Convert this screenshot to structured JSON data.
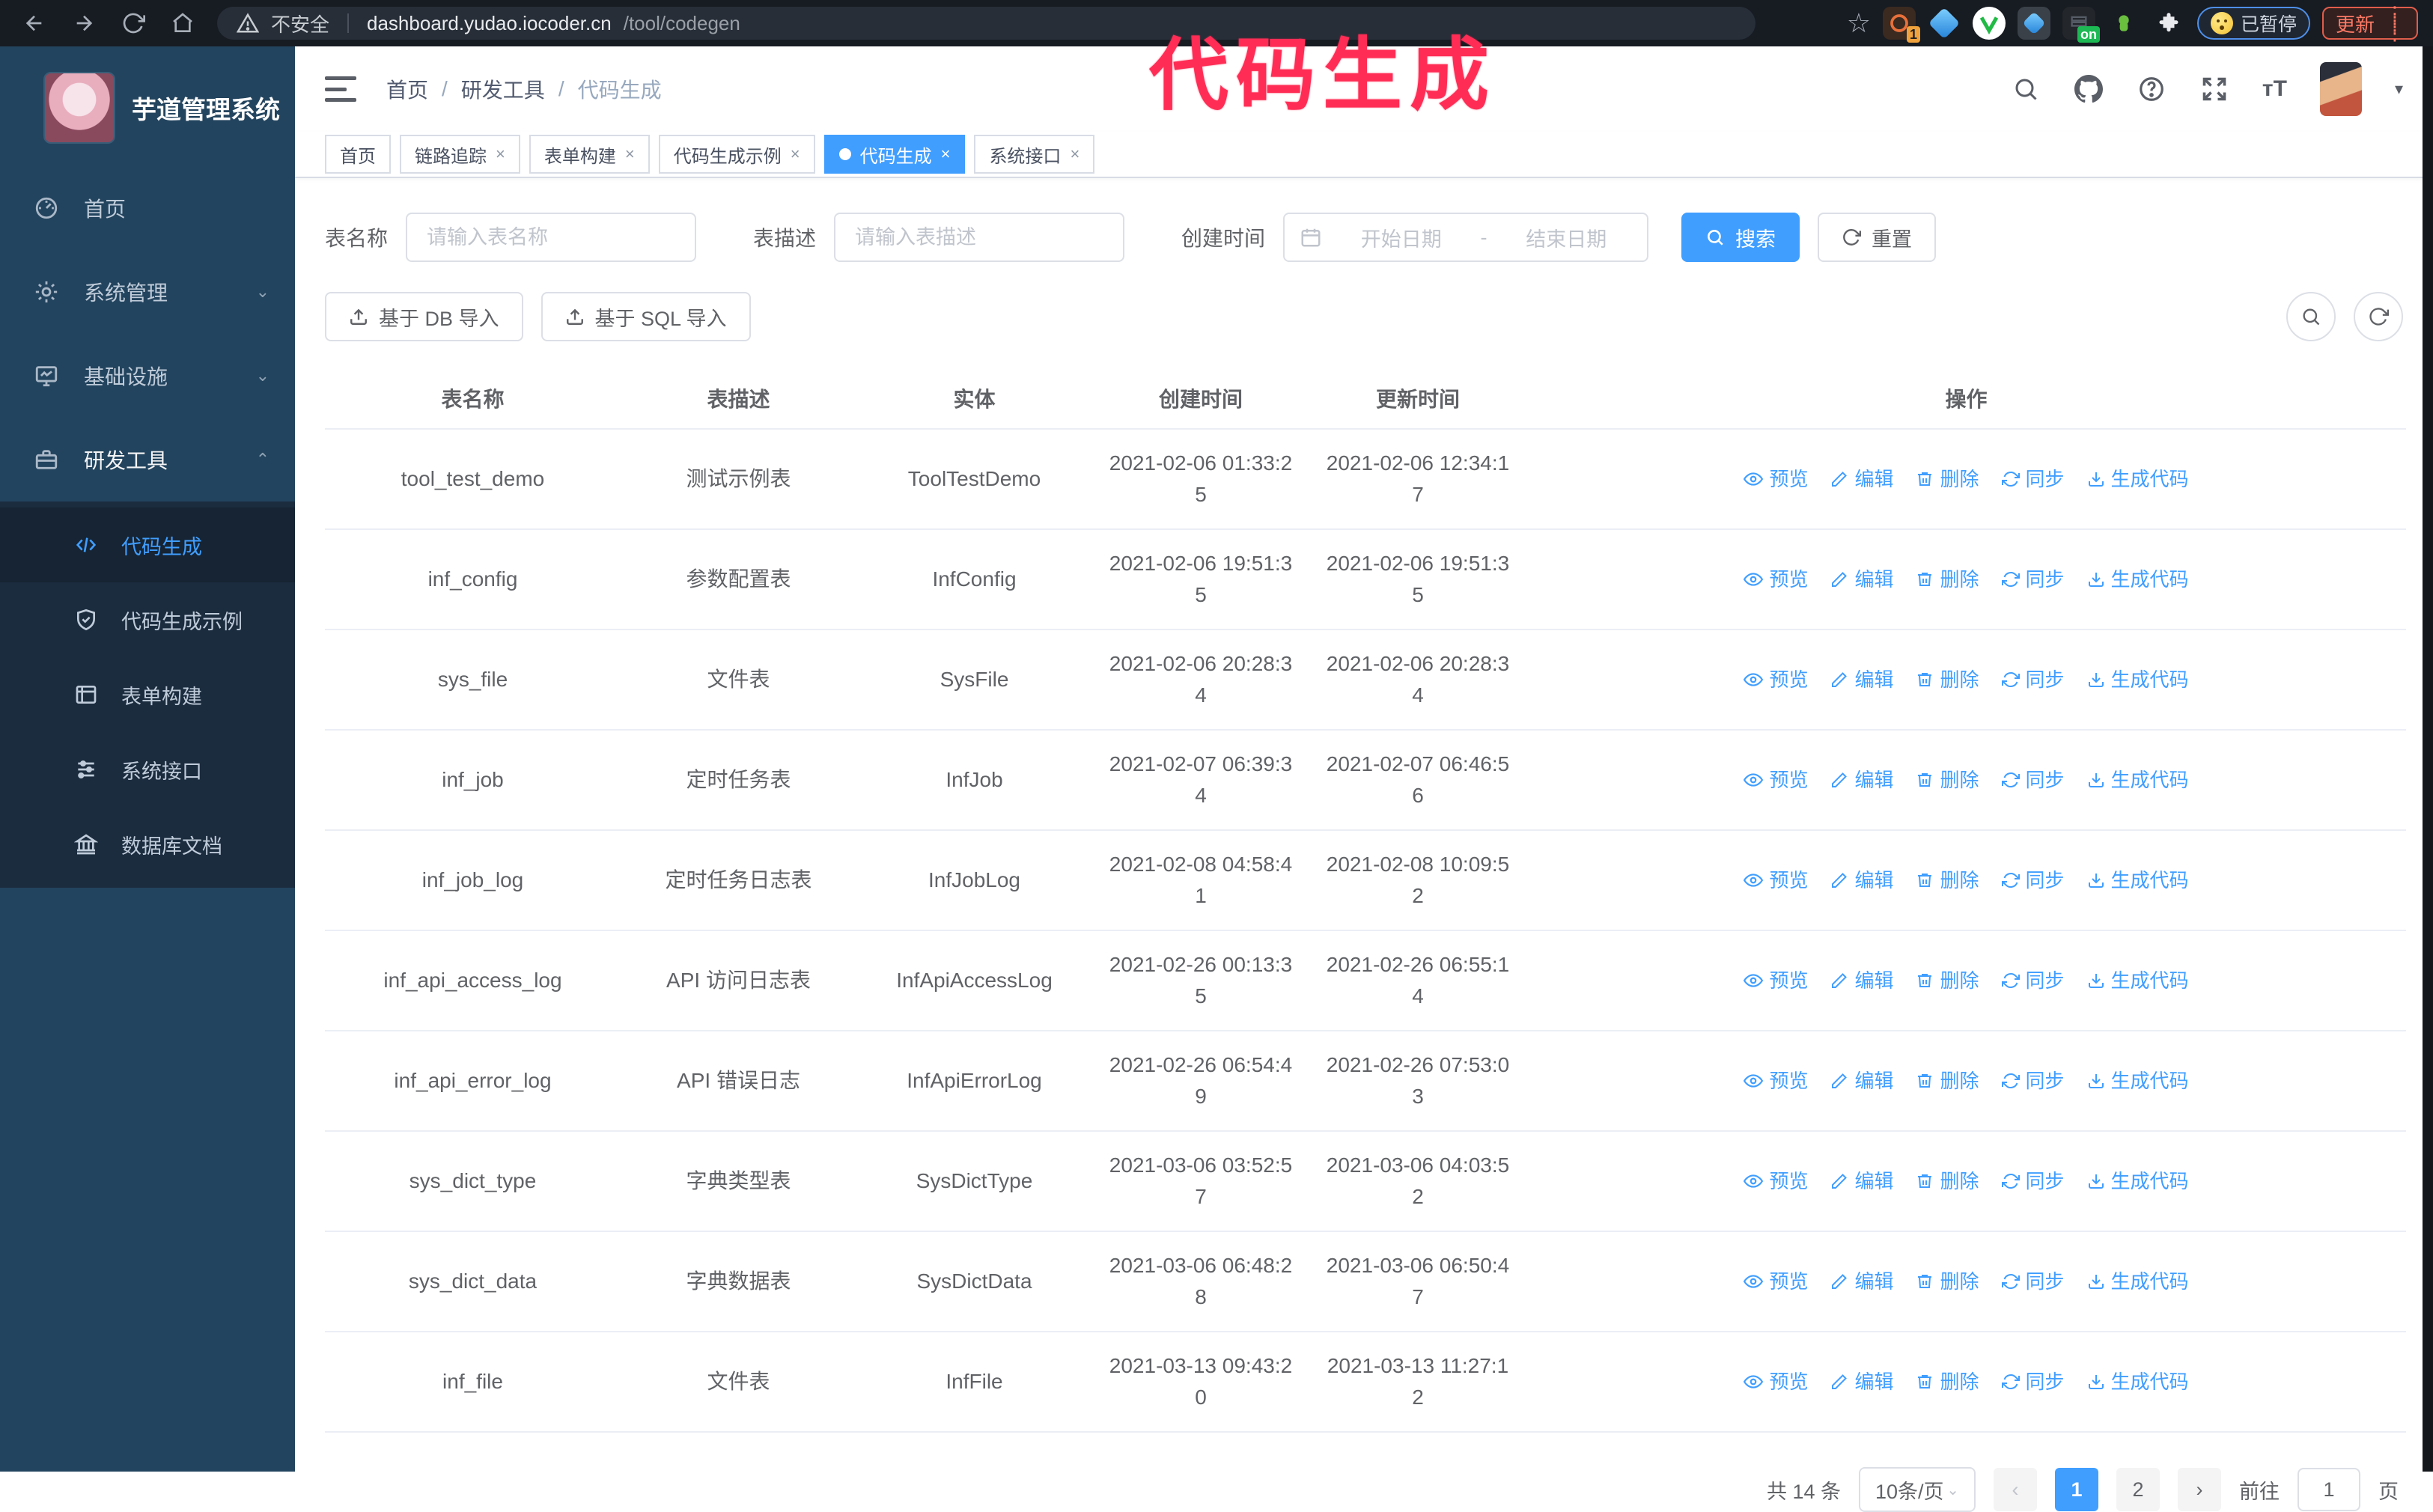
{
  "browser": {
    "security_label": "不安全",
    "url_host": "dashboard.yudao.iocoder.cn",
    "url_path": "/tool/codegen",
    "ext_badge_1": "1",
    "ext_on_badge": "on",
    "paused_label": "已暂停",
    "update_label": "更新"
  },
  "annotation": {
    "text": "代码生成",
    "color": "#ff2d55"
  },
  "sidebar": {
    "title": "芋道管理系统",
    "menu": [
      {
        "label": "首页"
      },
      {
        "label": "系统管理"
      },
      {
        "label": "基础设施"
      },
      {
        "label": "研发工具"
      }
    ],
    "submenu": [
      {
        "label": "代码生成"
      },
      {
        "label": "代码生成示例"
      },
      {
        "label": "表单构建"
      },
      {
        "label": "系统接口"
      },
      {
        "label": "数据库文档"
      }
    ]
  },
  "breadcrumb": [
    "首页",
    "研发工具",
    "代码生成"
  ],
  "tabs": [
    {
      "label": "首页"
    },
    {
      "label": "链路追踪"
    },
    {
      "label": "表单构建"
    },
    {
      "label": "代码生成示例"
    },
    {
      "label": "代码生成"
    },
    {
      "label": "系统接口"
    }
  ],
  "search": {
    "name_label": "表名称",
    "name_placeholder": "请输入表名称",
    "desc_label": "表描述",
    "desc_placeholder": "请输入表描述",
    "time_label": "创建时间",
    "start_placeholder": "开始日期",
    "range_separator": "-",
    "end_placeholder": "结束日期",
    "search_label": "搜索",
    "reset_label": "重置"
  },
  "toolbar": {
    "import_db_label": "基于 DB 导入",
    "import_sql_label": "基于 SQL 导入"
  },
  "table": {
    "columns": [
      "表名称",
      "表描述",
      "实体",
      "创建时间",
      "更新时间",
      "操作"
    ],
    "actions": [
      {
        "label": "预览"
      },
      {
        "label": "编辑"
      },
      {
        "label": "删除"
      },
      {
        "label": "同步"
      },
      {
        "label": "生成代码"
      }
    ],
    "rows": [
      {
        "name": "tool_test_demo",
        "desc": "测试示例表",
        "entity": "ToolTestDemo",
        "created": "2021-02-06 01:33:25",
        "updated": "2021-02-06 12:34:17"
      },
      {
        "name": "inf_config",
        "desc": "参数配置表",
        "entity": "InfConfig",
        "created": "2021-02-06 19:51:35",
        "updated": "2021-02-06 19:51:35"
      },
      {
        "name": "sys_file",
        "desc": "文件表",
        "entity": "SysFile",
        "created": "2021-02-06 20:28:34",
        "updated": "2021-02-06 20:28:34"
      },
      {
        "name": "inf_job",
        "desc": "定时任务表",
        "entity": "InfJob",
        "created": "2021-02-07 06:39:34",
        "updated": "2021-02-07 06:46:56"
      },
      {
        "name": "inf_job_log",
        "desc": "定时任务日志表",
        "entity": "InfJobLog",
        "created": "2021-02-08 04:58:41",
        "updated": "2021-02-08 10:09:52"
      },
      {
        "name": "inf_api_access_log",
        "desc": "API 访问日志表",
        "entity": "InfApiAccessLog",
        "created": "2021-02-26 00:13:35",
        "updated": "2021-02-26 06:55:14"
      },
      {
        "name": "inf_api_error_log",
        "desc": "API 错误日志",
        "entity": "InfApiErrorLog",
        "created": "2021-02-26 06:54:49",
        "updated": "2021-02-26 07:53:03"
      },
      {
        "name": "sys_dict_type",
        "desc": "字典类型表",
        "entity": "SysDictType",
        "created": "2021-03-06 03:52:57",
        "updated": "2021-03-06 04:03:52"
      },
      {
        "name": "sys_dict_data",
        "desc": "字典数据表",
        "entity": "SysDictData",
        "created": "2021-03-06 06:48:28",
        "updated": "2021-03-06 06:50:47"
      },
      {
        "name": "inf_file",
        "desc": "文件表",
        "entity": "InfFile",
        "created": "2021-03-13 09:43:20",
        "updated": "2021-03-13 11:27:12"
      }
    ]
  },
  "pagination": {
    "total_label": "共 14 条",
    "page_size": "10条/页",
    "prev": "‹",
    "next": "›",
    "pages": [
      "1",
      "2"
    ],
    "goto_label": "前往",
    "goto_value": "1",
    "page_label": "页"
  },
  "colors": {
    "primary": "#409EFF",
    "sidebar_bg": "#23445e",
    "submenu_bg": "#1b2c3f",
    "active_tag": "#409EFF"
  }
}
